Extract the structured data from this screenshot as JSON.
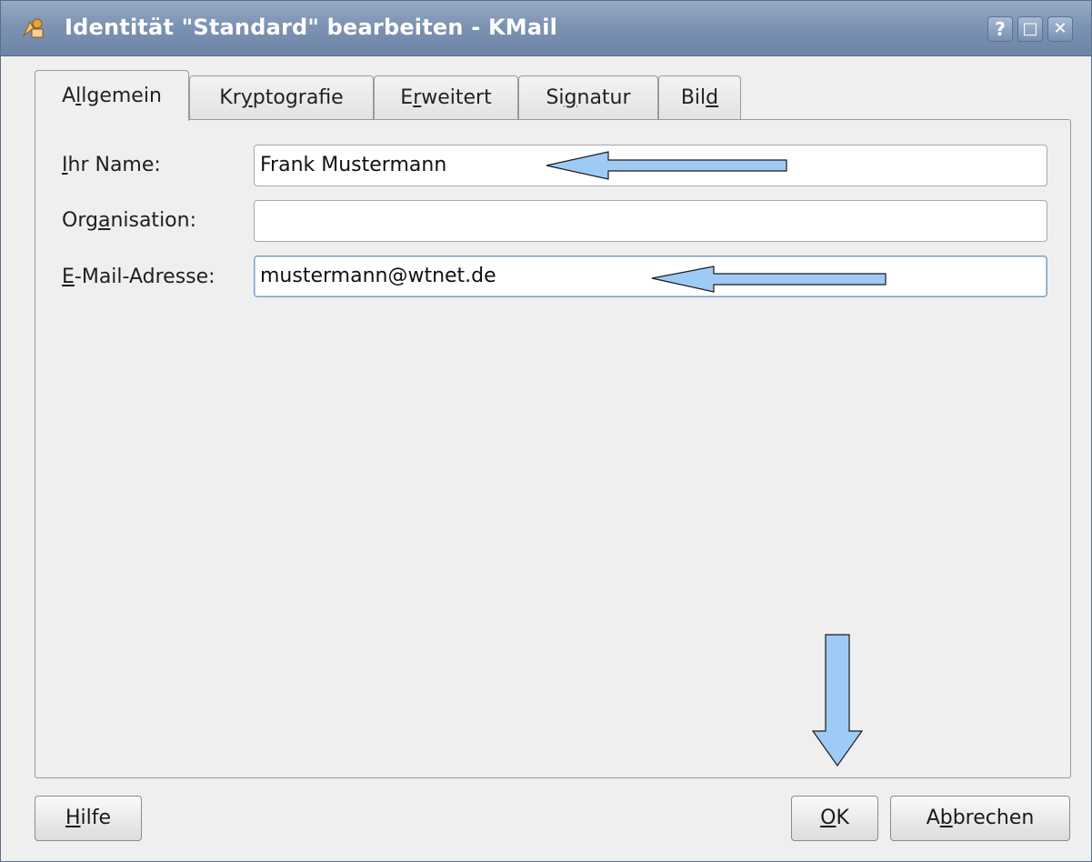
{
  "window": {
    "title": "Identität \"Standard\" bearbeiten - KMail",
    "help_btn": "?",
    "maximize_btn": "□",
    "close_btn": "✕"
  },
  "tabs": [
    {
      "pre": "A",
      "ul": "l",
      "post": "lgemein"
    },
    {
      "pre": "Kr",
      "ul": "y",
      "post": "ptografie"
    },
    {
      "pre": "E",
      "ul": "r",
      "post": "weitert"
    },
    {
      "pre": "Si",
      "ul": "g",
      "post": "natur"
    },
    {
      "pre": "Bil",
      "ul": "d",
      "post": ""
    }
  ],
  "form": {
    "name_label": {
      "pre": "",
      "ul": "I",
      "post": "hr Name:"
    },
    "name_value": "Frank Mustermann",
    "org_label": {
      "pre": "Org",
      "ul": "a",
      "post": "nisation:"
    },
    "org_value": "",
    "email_label": {
      "pre": "",
      "ul": "E",
      "post": "-Mail-Adresse:"
    },
    "email_value": "mustermann@wtnet.de"
  },
  "buttons": {
    "help": {
      "pre": "",
      "ul": "H",
      "post": "ilfe"
    },
    "ok": {
      "pre": "",
      "ul": "O",
      "post": "K"
    },
    "cancel": {
      "pre": "A",
      "ul": "b",
      "post": "brechen"
    }
  },
  "colors": {
    "annotation_arrow": "#9ecbf5",
    "titlebar": "#7d93b3"
  }
}
